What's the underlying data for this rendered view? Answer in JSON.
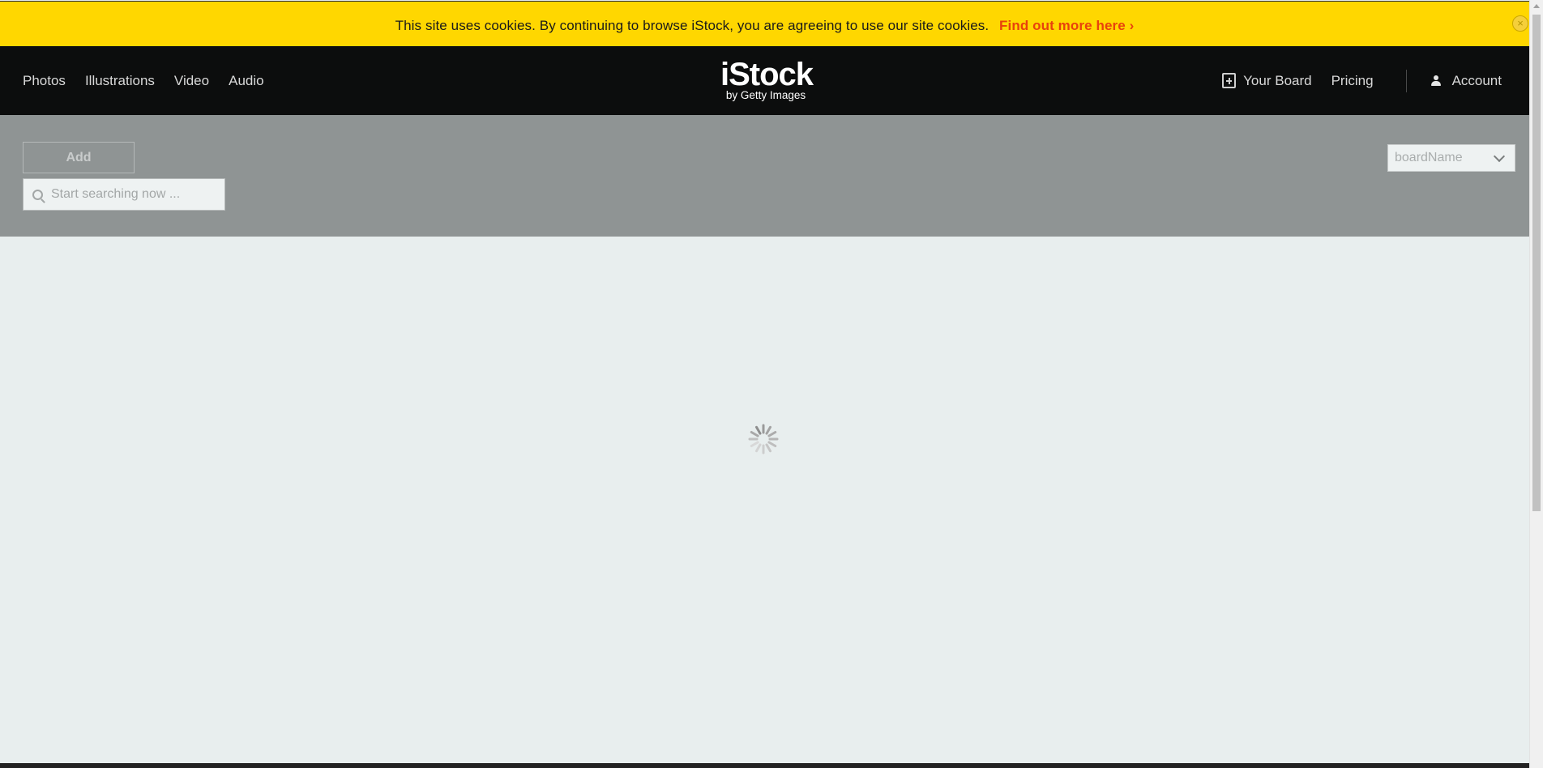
{
  "cookie_banner": {
    "message": "This site uses cookies. By continuing to browse iStock, you are agreeing to use our site cookies.",
    "link_label": "Find out more here ›",
    "close_label": "×"
  },
  "header": {
    "nav": [
      {
        "label": "Photos"
      },
      {
        "label": "Illustrations"
      },
      {
        "label": "Video"
      },
      {
        "label": "Audio"
      }
    ],
    "logo": {
      "main": "iStock",
      "sub": "by Getty Images"
    },
    "your_board_label": "Your Board",
    "pricing_label": "Pricing",
    "account_label": "Account"
  },
  "toolbar": {
    "add_label": "Add",
    "search_placeholder": "Start searching now ...",
    "board_select_value": "boardName"
  },
  "colors": {
    "banner": "#ffd700",
    "link": "#e8410c",
    "header": "#0c0d0d",
    "toolbar": "#8f9494",
    "page": "#e8eeee"
  }
}
